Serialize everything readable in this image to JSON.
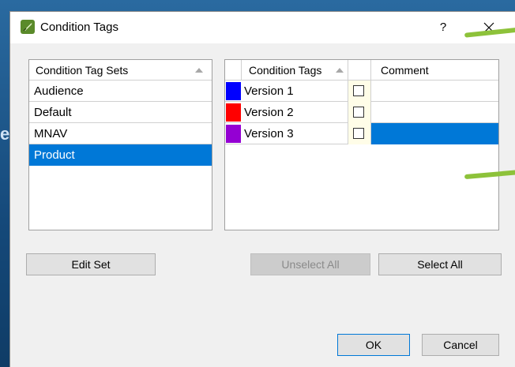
{
  "dialog": {
    "title": "Condition Tags",
    "help_label": "?",
    "icons": {
      "app": "pen-leaf-icon",
      "close": "close-icon"
    }
  },
  "desktop": {
    "partial_text": "e"
  },
  "sets": {
    "header": "Condition Tag Sets",
    "items": [
      {
        "label": "Audience",
        "selected": false
      },
      {
        "label": "Default",
        "selected": false
      },
      {
        "label": "MNAV",
        "selected": false
      },
      {
        "label": "Product",
        "selected": true
      }
    ]
  },
  "tags": {
    "headers": {
      "name": "Condition Tags",
      "comment": "Comment"
    },
    "rows": [
      {
        "name": "Version 1",
        "color": "#0000ff",
        "checked": false,
        "comment": "",
        "selected": false
      },
      {
        "name": "Version 2",
        "color": "#ff0000",
        "checked": false,
        "comment": "",
        "selected": false
      },
      {
        "name": "Version 3",
        "color": "#9400d3",
        "checked": false,
        "comment": "",
        "selected": true
      }
    ]
  },
  "buttons": {
    "edit_set": "Edit Set",
    "unselect_all": "Unselect All",
    "select_all": "Select All",
    "ok": "OK",
    "cancel": "Cancel"
  },
  "colors": {
    "selection": "#0078d7",
    "annotation": "#8dc23a"
  }
}
